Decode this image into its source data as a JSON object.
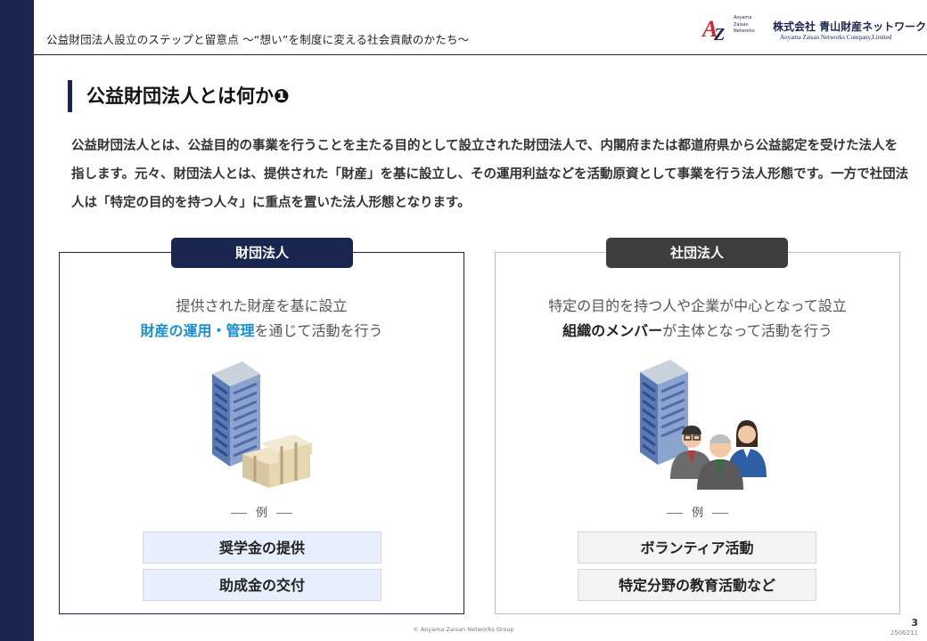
{
  "header": {
    "title": "公益財団法人設立のステップと留意点 〜“想い”を制度に変える社会貢献のかたち〜",
    "logo": {
      "mark_lines": [
        "Aoyama",
        "Zaisan",
        "Networks"
      ],
      "company_jp": "株式会社 青山財産ネットワークス",
      "company_en": "Aoyama Zaisan Networks Company,Limited"
    }
  },
  "section": {
    "title": "公益財団法人とは何か❶"
  },
  "intro": "公益財団法人とは、公益目的の事業を行うことを主たる目的として設立された財団法人で、内閣府または都道府県から公益認定を受けた法人を指します。元々、財団法人とは、提供された「財産」を基に設立し、その運用利益などを活動原資として事業を行う法人形態です。一方で社団法人は「特定の目的を持つ人々」に重点を置いた法人形態となります。",
  "panels": [
    {
      "badge": "財団法人",
      "desc_line1": "提供された財産を基に設立",
      "desc_highlight": "財産の運用・管理",
      "desc_line2_rest": "を通じて活動を行う",
      "example_label": "例",
      "examples": [
        "奨学金の提供",
        "助成金の交付"
      ],
      "illustration": "building-and-money-icon"
    },
    {
      "badge": "社団法人",
      "desc_line1": "特定の目的を持つ人や企業が中心となって設立",
      "desc_highlight": "組織のメンバー",
      "desc_line2_rest": "が主体となって活動を行う",
      "example_label": "例",
      "examples": [
        "ボランティア活動",
        "特定分野の教育活動など"
      ],
      "illustration": "building-and-people-icon"
    }
  ],
  "footer": {
    "copyright": "© Aoyama Zaisan Networks Group",
    "page_number": "3",
    "doc_code": "2506211"
  },
  "colors": {
    "navy": "#1a2550",
    "highlight_blue": "#1a8fd0",
    "dark_badge": "#3d3d3d",
    "example_blue_bg": "#e8eefb",
    "example_gray_bg": "#f3f3f3"
  }
}
